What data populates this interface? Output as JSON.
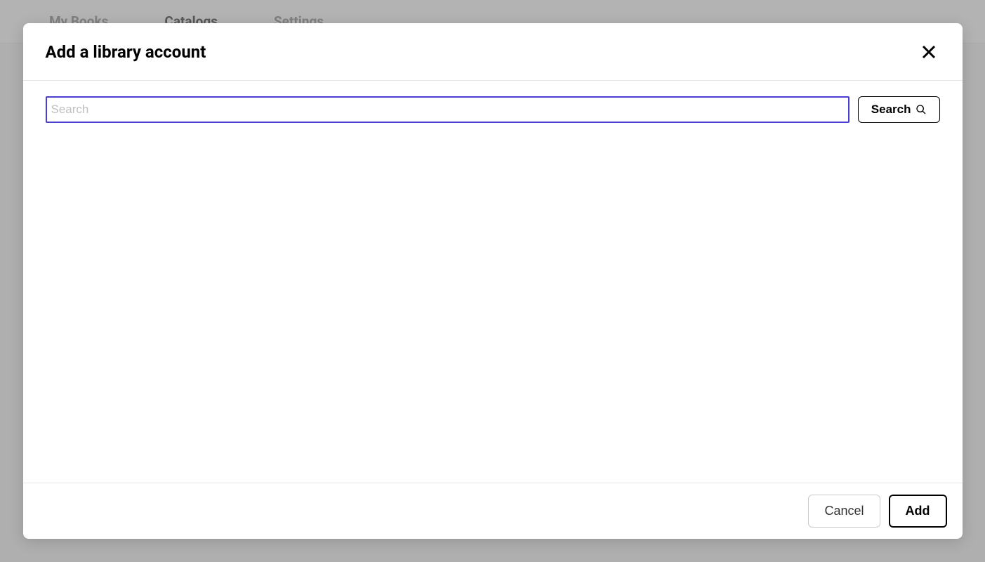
{
  "backdrop": {
    "tabs": [
      {
        "label": "My Books",
        "active": false
      },
      {
        "label": "Catalogs",
        "active": true
      },
      {
        "label": "Settings",
        "active": false
      }
    ]
  },
  "modal": {
    "title": "Add a library account",
    "search": {
      "placeholder": "Search",
      "value": "",
      "button_label": "Search"
    },
    "footer": {
      "cancel_label": "Cancel",
      "add_label": "Add"
    }
  }
}
